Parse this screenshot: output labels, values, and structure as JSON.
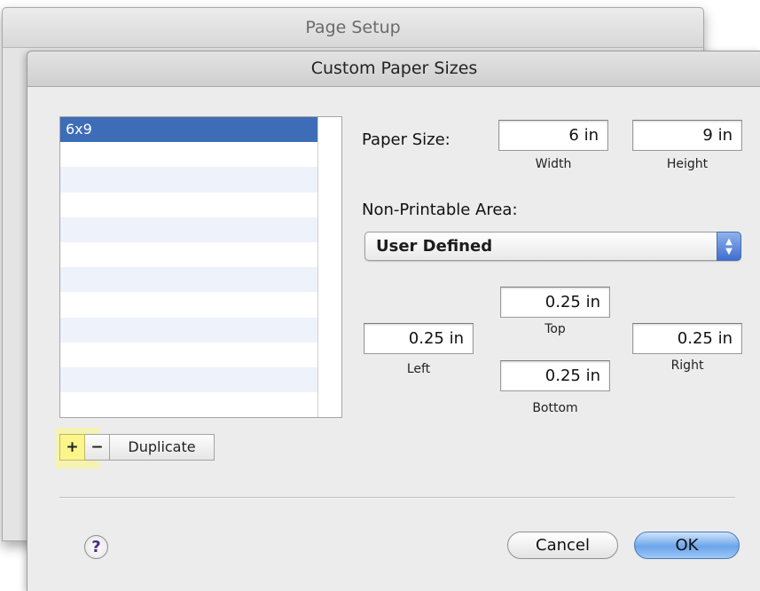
{
  "back_window": {
    "title": "Page Setup"
  },
  "sheet": {
    "title": "Custom Paper Sizes",
    "paper_list": {
      "items": [
        "6x9",
        "",
        "",
        "",
        "",
        "",
        "",
        "",
        "",
        "",
        "",
        ""
      ],
      "selected_index": 0
    },
    "list_buttons": {
      "add_label": "+",
      "remove_label": "−",
      "duplicate_label": "Duplicate"
    },
    "paper_size": {
      "label": "Paper Size:",
      "width_value": "6 in",
      "width_caption": "Width",
      "height_value": "9 in",
      "height_caption": "Height"
    },
    "non_printable": {
      "label": "Non-Printable Area:",
      "selected_option": "User Defined",
      "arrows_icon": "up-down-arrows-icon",
      "margins": {
        "top_value": "0.25 in",
        "top_caption": "Top",
        "left_value": "0.25 in",
        "left_caption": "Left",
        "right_value": "0.25 in",
        "right_caption": "Right",
        "bottom_value": "0.25 in",
        "bottom_caption": "Bottom"
      }
    },
    "footer": {
      "help_label": "?",
      "cancel_label": "Cancel",
      "ok_label": "OK"
    }
  },
  "colors": {
    "selection": "#3e6db8",
    "highlight": "#fbf58a",
    "default_button": "#6ba5ea"
  }
}
